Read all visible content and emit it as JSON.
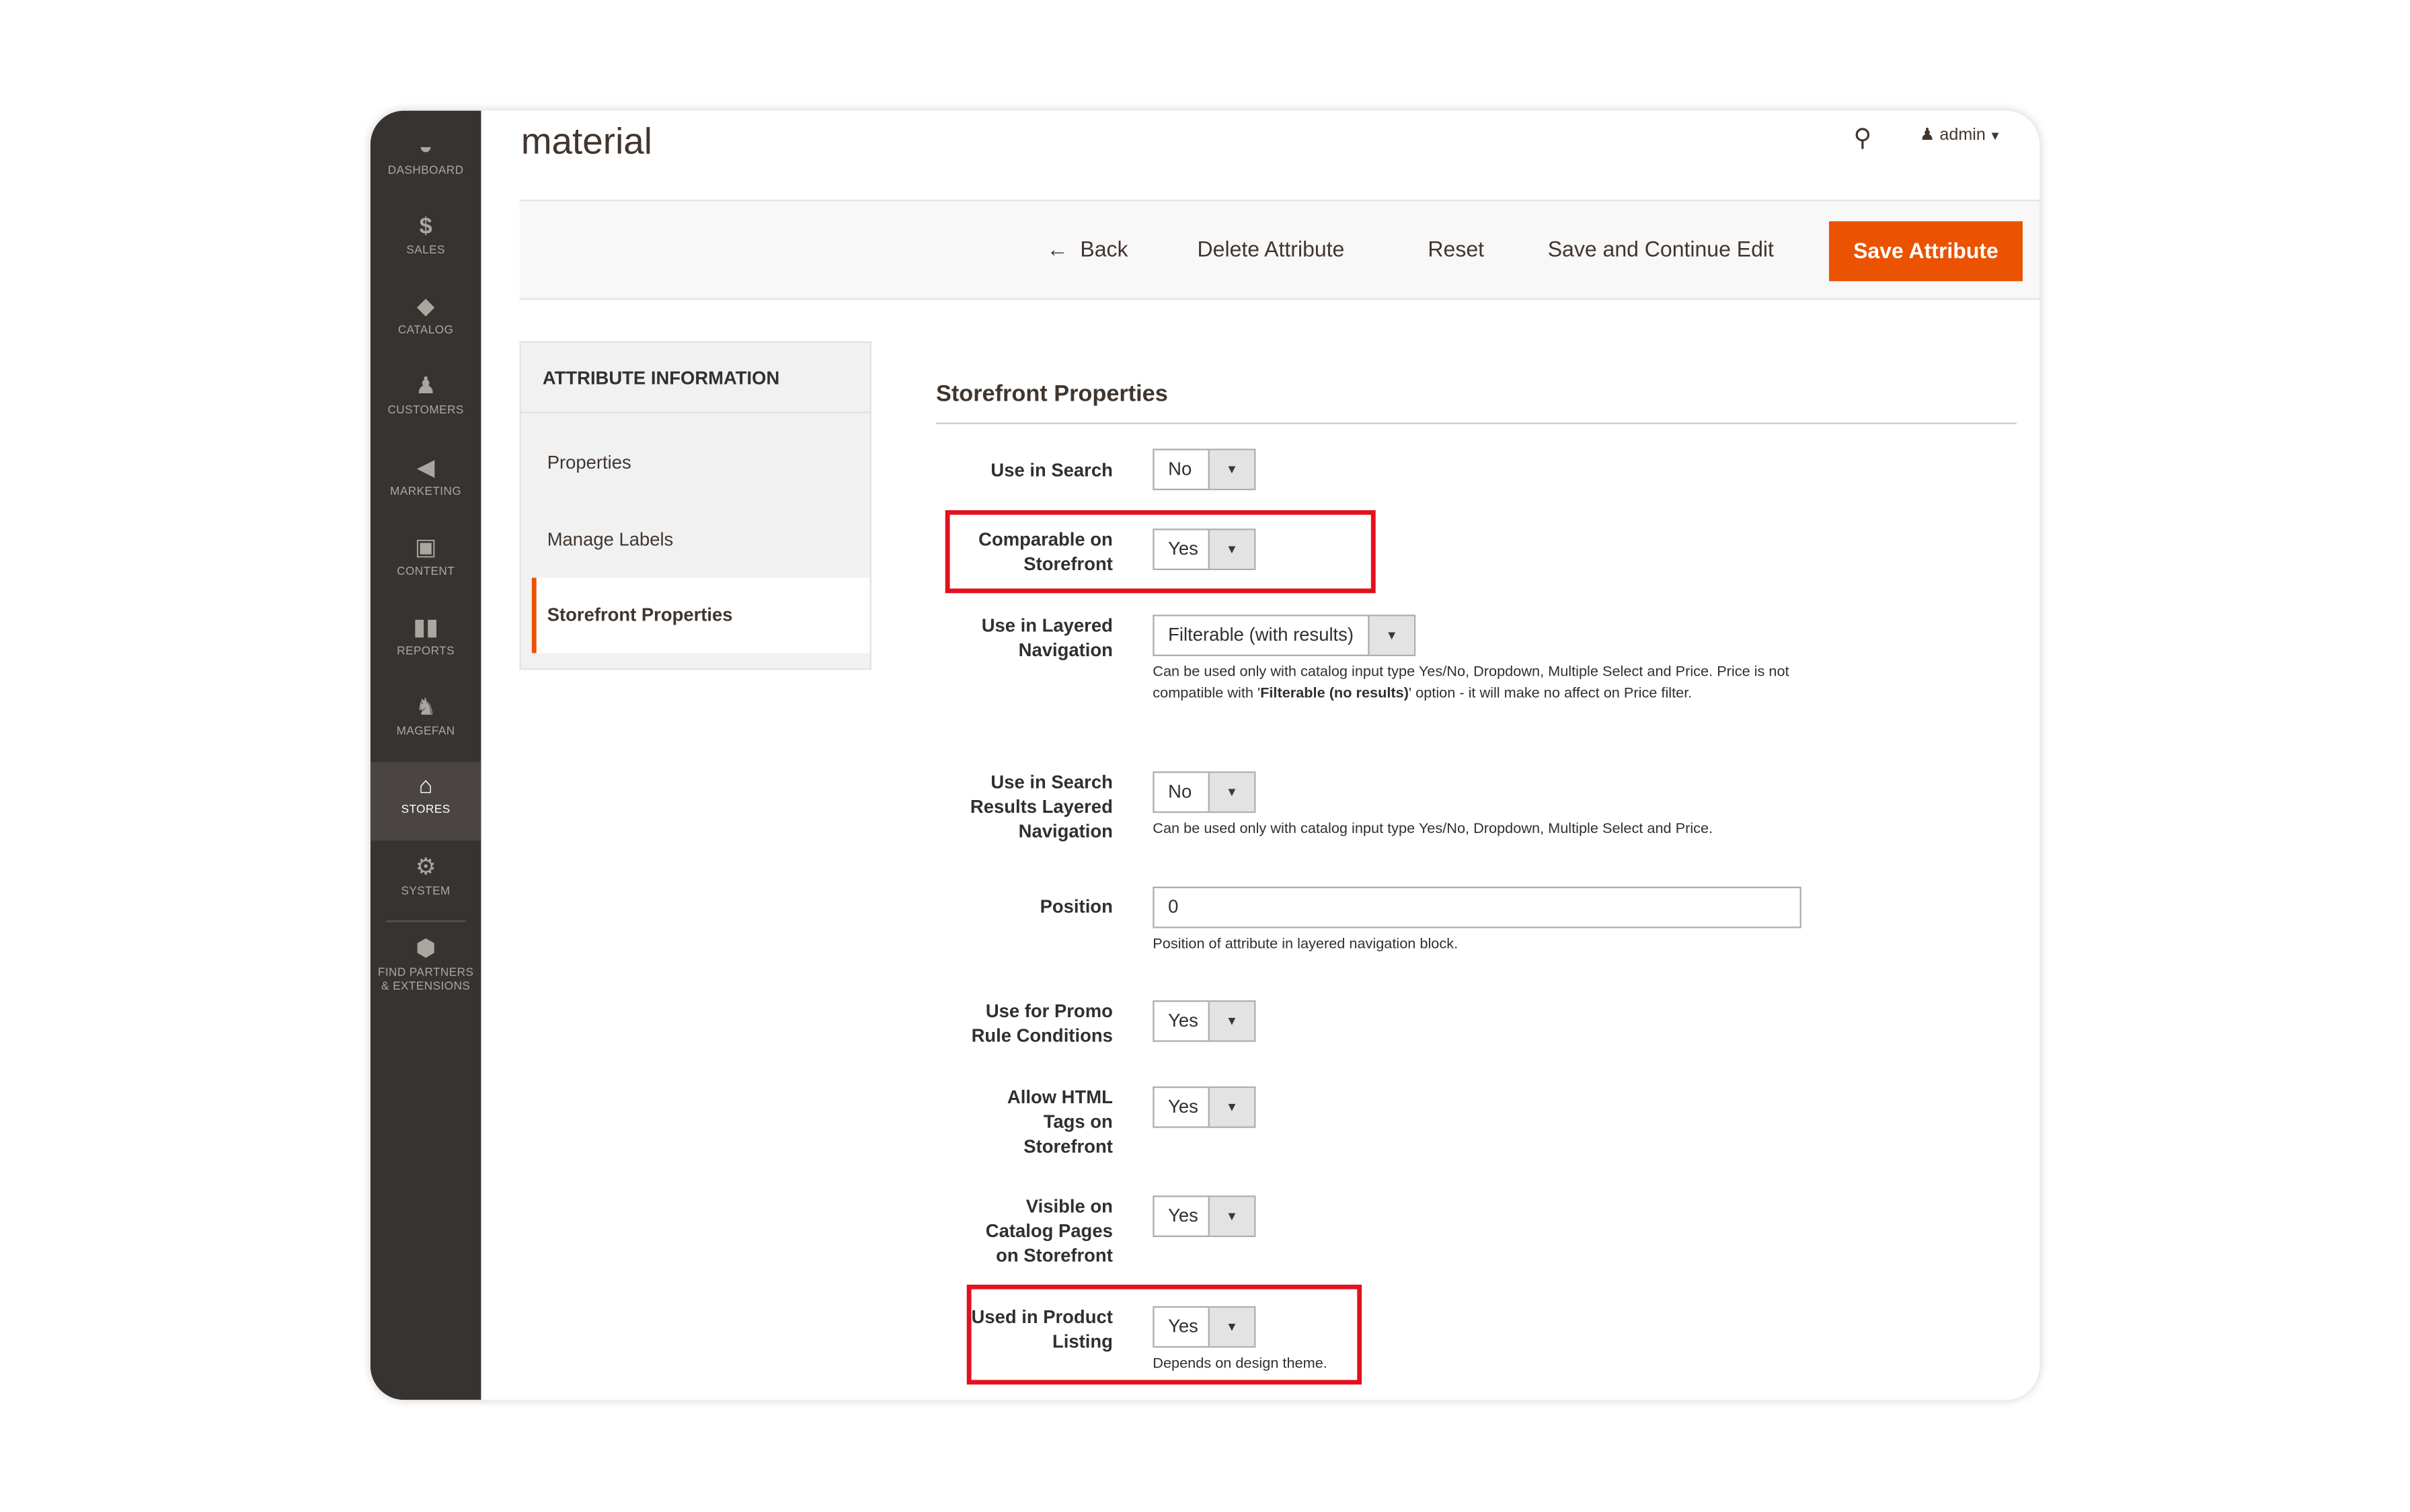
{
  "sidebar": {
    "items": [
      {
        "label": "DASHBOARD",
        "icon": "dashboard-icon"
      },
      {
        "label": "SALES",
        "icon": "dollar-icon"
      },
      {
        "label": "CATALOG",
        "icon": "box-icon"
      },
      {
        "label": "CUSTOMERS",
        "icon": "person-icon"
      },
      {
        "label": "MARKETING",
        "icon": "megaphone-icon"
      },
      {
        "label": "CONTENT",
        "icon": "layout-icon"
      },
      {
        "label": "REPORTS",
        "icon": "bar-chart-icon"
      },
      {
        "label": "MAGEFAN",
        "icon": "elephant-icon"
      },
      {
        "label": "STORES",
        "icon": "store-icon"
      },
      {
        "label": "SYSTEM",
        "icon": "gear-icon"
      },
      {
        "label": "FIND PARTNERS & EXTENSIONS",
        "icon": "cube-icon"
      }
    ]
  },
  "header": {
    "title": "material",
    "user": "admin"
  },
  "actions": {
    "back": "Back",
    "delete": "Delete Attribute",
    "reset": "Reset",
    "save_continue": "Save and Continue Edit",
    "save": "Save Attribute"
  },
  "tabs": {
    "heading": "ATTRIBUTE INFORMATION",
    "items": [
      "Properties",
      "Manage Labels",
      "Storefront Properties"
    ]
  },
  "section": {
    "title": "Storefront Properties"
  },
  "fields": {
    "use_in_search": {
      "label": "Use in Search",
      "value": "No"
    },
    "comparable": {
      "label": "Comparable on Storefront",
      "value": "Yes"
    },
    "layered": {
      "label": "Use in Layered Navigation",
      "value": "Filterable (with results)",
      "note1": "Can be used only with catalog input type Yes/No, Dropdown, Multiple Select and Price.",
      "note2a": "Price is not compatible with '",
      "note2b": "Filterable (no results)",
      "note2c": "' option - it will make no affect on Price filter."
    },
    "search_layered": {
      "label": "Use in Search Results Layered Navigation",
      "value": "No",
      "note": "Can be used only with catalog input type Yes/No, Dropdown, Multiple Select and Price."
    },
    "position": {
      "label": "Position",
      "value": "0",
      "note": "Position of attribute in layered navigation block."
    },
    "promo": {
      "label": "Use for Promo Rule Conditions",
      "value": "Yes"
    },
    "html_tags": {
      "label": "Allow HTML Tags on Storefront",
      "value": "Yes"
    },
    "visible": {
      "label": "Visible on Catalog Pages on Storefront",
      "value": "Yes"
    },
    "listing": {
      "label": "Used in Product Listing",
      "value": "Yes",
      "note": "Depends on design theme."
    }
  },
  "colors": {
    "accent": "#eb5202",
    "sidebar": "#373330",
    "highlight": "#e3101d"
  }
}
